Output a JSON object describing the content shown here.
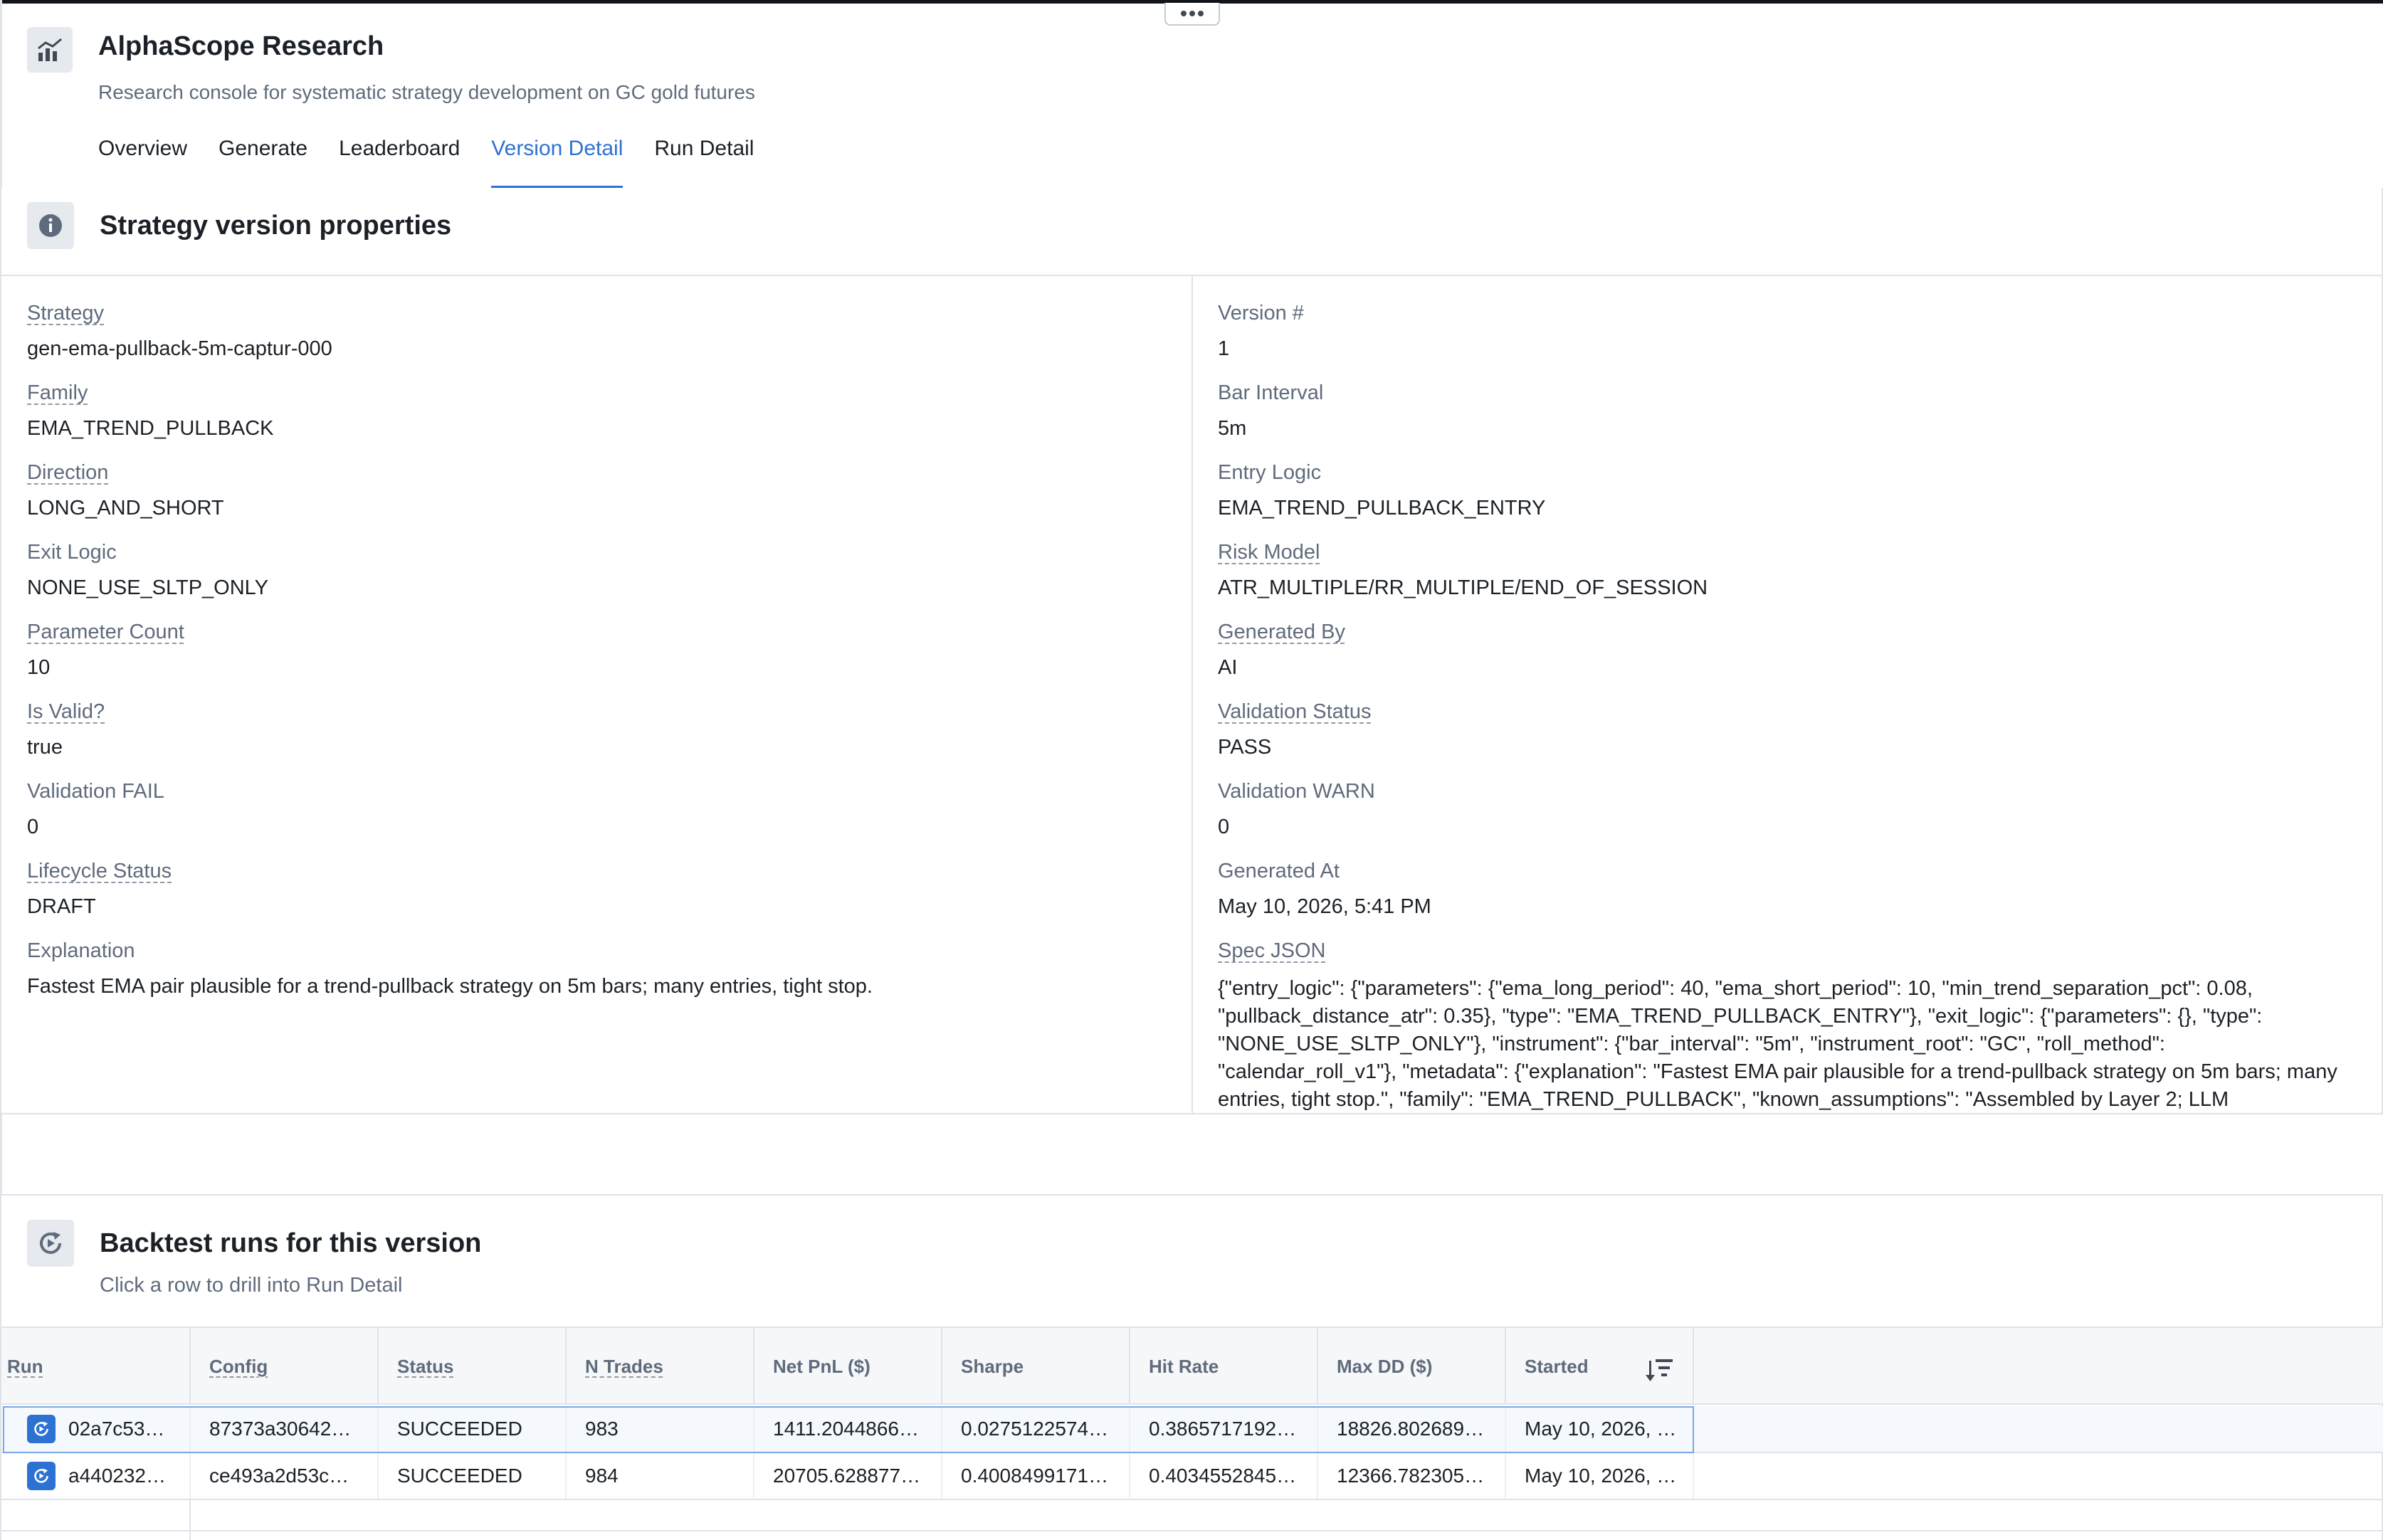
{
  "app": {
    "title": "AlphaScope Research",
    "subtitle": "Research console for systematic strategy development on GC gold futures",
    "tabs": [
      {
        "label": "Overview"
      },
      {
        "label": "Generate"
      },
      {
        "label": "Leaderboard"
      },
      {
        "label": "Version Detail",
        "active": true
      },
      {
        "label": "Run Detail"
      }
    ]
  },
  "properties": {
    "title": "Strategy version properties",
    "left": [
      {
        "label": "Strategy",
        "value": "gen-ema-pullback-5m-captur-000"
      },
      {
        "label": "Family",
        "value": "EMA_TREND_PULLBACK"
      },
      {
        "label": "Direction",
        "value": "LONG_AND_SHORT"
      },
      {
        "label": "Exit Logic",
        "value": "NONE_USE_SLTP_ONLY"
      },
      {
        "label": "Parameter Count",
        "value": "10"
      },
      {
        "label": "Is Valid?",
        "value": "true"
      },
      {
        "label": "Validation FAIL",
        "value": "0"
      },
      {
        "label": "Lifecycle Status",
        "value": "DRAFT"
      },
      {
        "label": "Explanation",
        "value": "Fastest EMA pair plausible for a trend-pullback strategy on 5m bars; many entries, tight stop."
      }
    ],
    "right": [
      {
        "label": "Version #",
        "value": "1"
      },
      {
        "label": "Bar Interval",
        "value": "5m"
      },
      {
        "label": "Entry Logic",
        "value": "EMA_TREND_PULLBACK_ENTRY"
      },
      {
        "label": "Risk Model",
        "value": "ATR_MULTIPLE/RR_MULTIPLE/END_OF_SESSION"
      },
      {
        "label": "Generated By",
        "value": "AI"
      },
      {
        "label": "Validation Status",
        "value": "PASS"
      },
      {
        "label": "Validation WARN",
        "value": "0"
      },
      {
        "label": "Generated At",
        "value": "May 10, 2026, 5:41 PM"
      },
      {
        "label": "Spec JSON",
        "value": "{\"entry_logic\": {\"parameters\": {\"ema_long_period\": 40, \"ema_short_period\": 10, \"min_trend_separation_pct\": 0.08, \"pullback_distance_atr\": 0.35}, \"type\": \"EMA_TREND_PULLBACK_ENTRY\"}, \"exit_logic\": {\"parameters\": {}, \"type\": \"NONE_USE_SLTP_ONLY\"}, \"instrument\": {\"bar_interval\": \"5m\", \"instrument_root\": \"GC\", \"roll_method\": \"calendar_roll_v1\"}, \"metadata\": {\"explanation\": \"Fastest EMA pair plausible for a trend-pullback strategy on 5m bars; many entries, tight stop.\", \"family\": \"EMA_TREND_PULLBACK\", \"known_assumptions\": \"Assembled by Layer 2; LLM"
      }
    ]
  },
  "runs": {
    "title": "Backtest runs for this version",
    "subtitle": "Click a row to drill into Run Detail",
    "columns": [
      "Run",
      "Config",
      "Status",
      "N Trades",
      "Net PnL ($)",
      "Sharpe",
      "Hit Rate",
      "Max DD ($)",
      "Started"
    ],
    "rows": [
      [
        "02a7c53…",
        "87373a30642…",
        "SUCCEEDED",
        "983",
        "1411.2044866…",
        "0.0275122574…",
        "0.3865717192…",
        "18826.802689…",
        "May 10, 2026, …"
      ],
      [
        "a440232…",
        "ce493a2d53c…",
        "SUCCEEDED",
        "984",
        "20705.628877…",
        "0.4008499171…",
        "0.4034552845…",
        "12366.782305…",
        "May 10, 2026, …"
      ]
    ]
  }
}
